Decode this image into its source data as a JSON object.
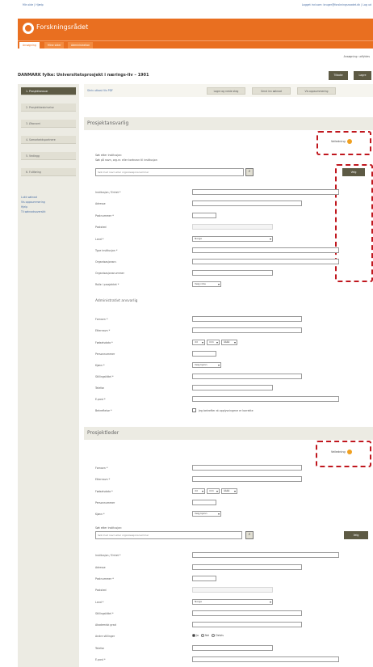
{
  "header": {
    "top_left_link": "Min side | Hjælp",
    "top_right_text": "Logget ind som: bruger@forskningsraadet.dk | Log ud",
    "logo_text": "Forskningsrådet",
    "tabs": [
      "Ansøgning",
      "Mine sider",
      "Administration"
    ],
    "sub_right_text": "Ansøgning: udfyldes"
  },
  "page": {
    "title": "DANMARK fylke: Universitetsprosjekt i nærings-liv – 1901",
    "btn_small": "Tilbake",
    "btn_save": "Lagre"
  },
  "sidebar": {
    "items": [
      "1. Prosjektansvar",
      "2. Prosjektbeskrivelse",
      "3. Økonomi",
      "4. Samarbeidspartnere",
      "5. Vedlegg",
      "6. Fullføring"
    ],
    "links": [
      "Lukk søknad",
      "Vis oppsummering",
      "Hjelp",
      "Til søknadsoversikt"
    ]
  },
  "toolbar": {
    "left_links": [
      "Skriv utkast",
      "Vis PDF"
    ],
    "buttons": [
      "Lagre og neste steg",
      "Send inn søknad",
      "Vis oppsummering"
    ]
  },
  "section1": {
    "header": "Prosjektansvarlig",
    "help_label": "Veiledning",
    "search_intro": "Søk etter institusjon:",
    "search_hint": "Søk på navn, org.nr. eller kortnavn til institusjon",
    "search_placeholder": "Søk med navn eller organisasjonsnummer",
    "next_button": "Velg",
    "fields": [
      "Institusjon / Enhet *",
      "Adresse",
      "Postnummer *",
      "Poststed",
      "Land *",
      "Type institusjon *",
      "Organisasjonsnr.",
      "Organisasjonsnummer",
      "Rolle i prosjektet *"
    ],
    "land_value": "Norge",
    "role_value": "Velg rolle",
    "admin_header": "Administrativt ansvarlig",
    "admin_fields": [
      "Fornavn *",
      "Etternavn *",
      "Fødselsdato *",
      "Personnummer",
      "Kjønn *",
      "Stillingstittel *",
      "Telefon",
      "E-post *",
      "Bekreftelse *"
    ],
    "gender_value": "Velg kjønn",
    "date_parts": [
      "dd",
      "mm",
      "åååå"
    ],
    "confirm_text": "Jeg bekrefter at opplysningene er korrekte"
  },
  "section2": {
    "header": "Prosjektleder",
    "help_label": "Veiledning",
    "fields": [
      "Fornavn *",
      "Etternavn *",
      "Fødselsdato *",
      "Personnummer",
      "Kjønn *"
    ],
    "gender_value": "Velg kjønn",
    "date_parts": [
      "dd",
      "mm",
      "åååå"
    ],
    "search_intro": "Søk etter institusjon:",
    "search_placeholder": "Søk med navn eller organisasjonsnummer",
    "next_button": "Velg",
    "fields2": [
      "Institusjon / Enhet *",
      "Adresse",
      "Postnummer *",
      "Poststed",
      "Land *",
      "Stillingstittel *",
      "Akademisk grad",
      "Andre stillinger",
      "Telefon",
      "E-post *"
    ],
    "land_value": "Norge",
    "radios": [
      "Ja",
      "Nei",
      "Delvis"
    ]
  }
}
